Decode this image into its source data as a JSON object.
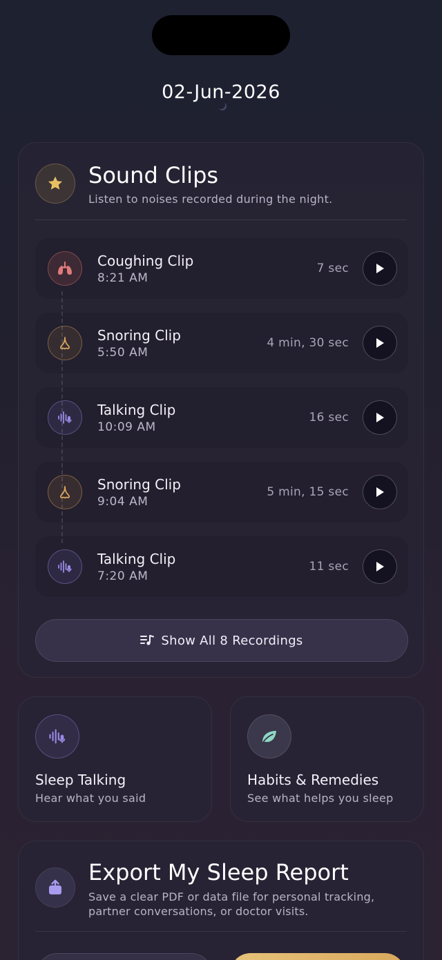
{
  "date": "02-Jun-2026",
  "sound_clips": {
    "title": "Sound Clips",
    "subtitle": "Listen to noises recorded during the night.",
    "clips": [
      {
        "name": "Coughing Clip",
        "time": "8:21 AM",
        "duration": "7 sec",
        "type": "cough"
      },
      {
        "name": "Snoring Clip",
        "time": "5:50 AM",
        "duration": "4 min, 30 sec",
        "type": "snore"
      },
      {
        "name": "Talking Clip",
        "time": "10:09 AM",
        "duration": "16 sec",
        "type": "talk"
      },
      {
        "name": "Snoring Clip",
        "time": "9:04 AM",
        "duration": "5 min, 15 sec",
        "type": "snore"
      },
      {
        "name": "Talking Clip",
        "time": "7:20 AM",
        "duration": "11 sec",
        "type": "talk"
      }
    ],
    "show_all_label": "Show All 8 Recordings"
  },
  "mini_cards": [
    {
      "title": "Sleep Talking",
      "subtitle": "Hear what you said",
      "icon": "waveform-mic-icon"
    },
    {
      "title": "Habits & Remedies",
      "subtitle": "See what helps you sleep",
      "icon": "leaf-icon"
    }
  ],
  "export": {
    "title": "Export My Sleep Report",
    "subtitle": "Save a clear PDF or data file for personal tracking, partner conversations, or doctor visits."
  },
  "colors": {
    "accent_gold": "#e7c27a",
    "cough": "#e07a7a",
    "snore": "#d9a45e",
    "talk": "#9b8ae6",
    "leaf": "#8fd6c4"
  }
}
